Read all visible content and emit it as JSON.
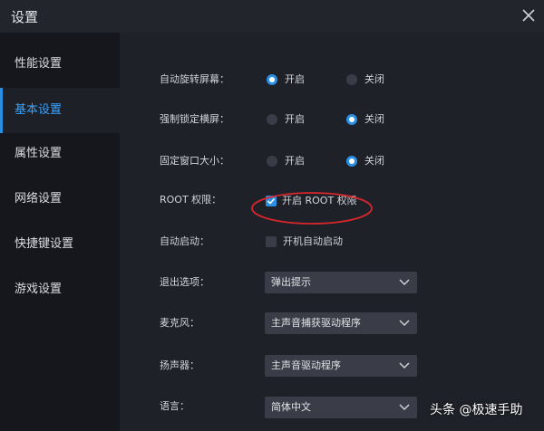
{
  "window": {
    "title": "设置"
  },
  "sidebar": {
    "items": [
      {
        "label": "性能设置"
      },
      {
        "label": "基本设置"
      },
      {
        "label": "属性设置"
      },
      {
        "label": "网络设置"
      },
      {
        "label": "快捷键设置"
      },
      {
        "label": "游戏设置"
      }
    ],
    "active_index": 1
  },
  "settings": {
    "auto_rotate": {
      "label": "自动旋转屏幕：",
      "on_label": "开启",
      "off_label": "关闭",
      "selected": "on"
    },
    "force_landscape": {
      "label": "强制锁定横屏：",
      "on_label": "开启",
      "off_label": "关闭",
      "selected": "off"
    },
    "fixed_window": {
      "label": "固定窗口大小：",
      "on_label": "开启",
      "off_label": "关闭",
      "selected": "off"
    },
    "root": {
      "label": "ROOT 权限：",
      "checkbox_label": "开启 ROOT 权限",
      "checked": true
    },
    "autostart": {
      "label": "自动启动：",
      "checkbox_label": "开机自动启动",
      "checked": false
    },
    "exit_option": {
      "label": "退出选项：",
      "value": "弹出提示"
    },
    "microphone": {
      "label": "麦克风：",
      "value": "主声音捕获驱动程序"
    },
    "speaker": {
      "label": "扬声器：",
      "value": "主声音驱动程序"
    },
    "language": {
      "label": "语言：",
      "value": "简体中文"
    }
  },
  "watermark": "头条 @极速手助",
  "colors": {
    "accent": "#2b8fe6",
    "highlight_ellipse": "#d8262c",
    "sidebar_bg": "#16171c",
    "content_bg": "#1f2128"
  }
}
